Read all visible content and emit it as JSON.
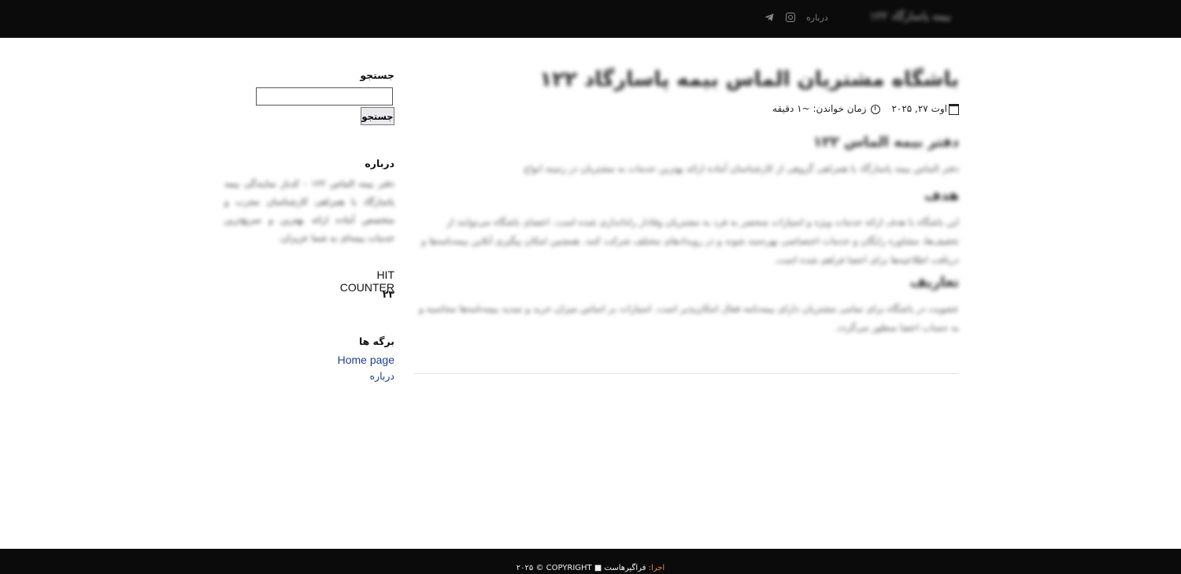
{
  "topbar": {
    "brand": "بیمه پاسارگاد ۱۲۲",
    "nav_about": "درباره",
    "social": {
      "instagram_icon": "instagram-icon",
      "telegram_icon": "telegram-icon"
    }
  },
  "post": {
    "title": "باشگاه مشتریان الماس بیمه پاسارگاد ۱۲۲",
    "date": "اوت ۲۷, ۲۰۲۵",
    "reading_time": "زمان خواندن: ~۱ دقیقه",
    "h2_1": "دفتر بیمه الماس ۱۲۲",
    "p1": "دفتر الماس بیمه پاسارگاد با همراهی گروهی از کارشناسان آماده ارائه بهترین خدمات به مشتریان در زمینه انواع بیمه‌نامه‌ها است.",
    "h2_2": "هدف",
    "p2": "این باشگاه با هدف ارائه خدمات ویژه و امتیازات منحصر به فرد به مشتریان وفادار راه‌اندازی شده است. اعضای باشگاه می‌توانند از تخفیف‌ها، مشاوره رایگان و خدمات اختصاصی بهره‌مند شوند و در رویدادهای مختلف شرکت کنند. همچنین امکان پیگیری آنلاین بیمه‌نامه‌ها و دریافت اطلاعیه‌ها برای اعضا فراهم شده است.",
    "h2_3": "تعاریف",
    "p3": "عضویت در باشگاه برای تمامی مشتریان دارای بیمه‌نامه فعال امکان‌پذیر است. امتیازات بر اساس میزان خرید و تمدید بیمه‌نامه‌ها محاسبه و به حساب اعضا منظور می‌گردد."
  },
  "sidebar": {
    "search": {
      "heading": "جستجو",
      "input_value": "",
      "button_label": "جستجو"
    },
    "about": {
      "heading": "درباره",
      "text": "دفتر بیمه الماس ۱۲۲ - کدباز نمایندگی بیمه پاسارگاد با همراهی کارشناسان مجرب و متخصص آماده ارائه بهترین و سریع‌ترین خدمات بیمه‌ای به شما عزیزان."
    },
    "hit_counter": {
      "title": "HIT COUNTER",
      "count": "۲۳"
    },
    "pages": {
      "heading": "برگه ها",
      "items": [
        {
          "label": "Home page"
        },
        {
          "label": "درباره"
        }
      ]
    }
  },
  "footer": {
    "copyright": "۲۰۲۵ © COPYRIGHT",
    "run_by_prefix": "اجرا:",
    "run_by_name": "فراگیرهاست"
  },
  "colors": {
    "topbar_bg": "#0b0b0c",
    "link": "#1b3f8f",
    "footer_accent": "#e08a46"
  }
}
